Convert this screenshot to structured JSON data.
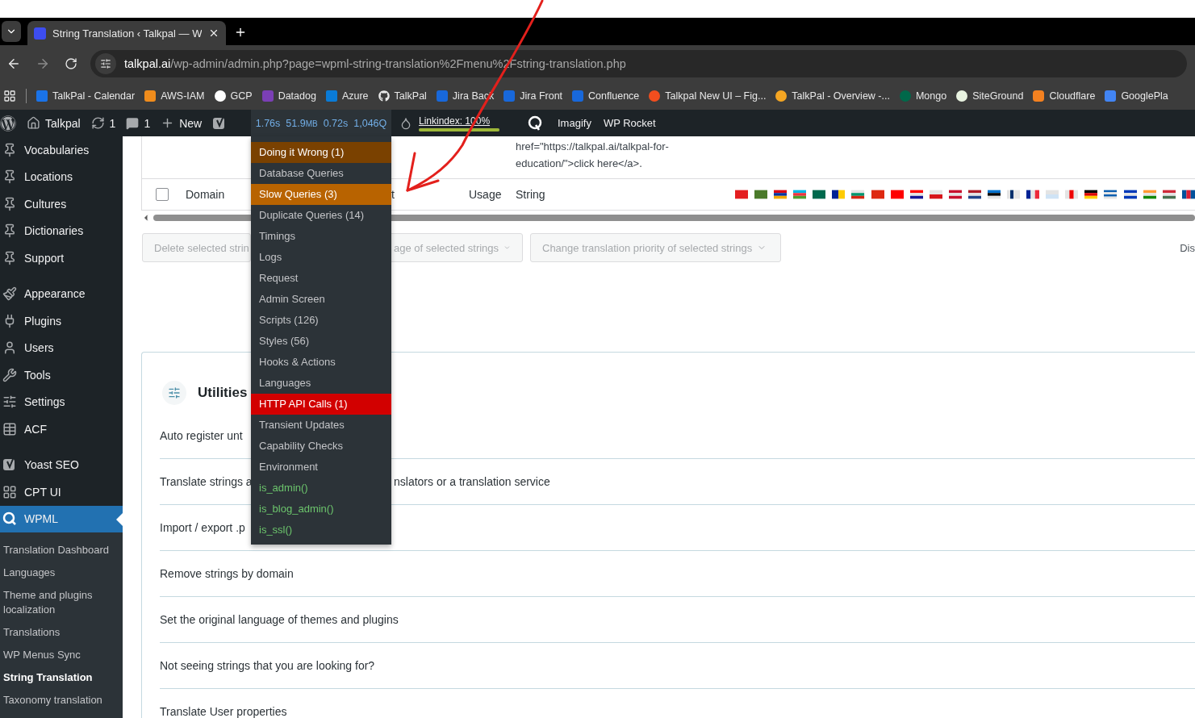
{
  "browser": {
    "tab": {
      "title": "String Translation ‹ Talkpal — W",
      "selected": true
    },
    "url": {
      "host": "talkpal.ai",
      "path": "/wp-admin/admin.php?page=wpml-string-translation%2Fmenu%2Fstring-translation.php"
    },
    "bookmarks": [
      {
        "label": "TalkPal - Calendar"
      },
      {
        "label": "AWS-IAM"
      },
      {
        "label": "GCP"
      },
      {
        "label": "Datadog"
      },
      {
        "label": "Azure"
      },
      {
        "label": "TalkPal"
      },
      {
        "label": "Jira Back"
      },
      {
        "label": "Jira Front"
      },
      {
        "label": "Confluence"
      },
      {
        "label": "Talkpal New UI – Fig..."
      },
      {
        "label": "TalkPal - Overview -..."
      },
      {
        "label": "Mongo"
      },
      {
        "label": "SiteGround"
      },
      {
        "label": "Cloudflare"
      },
      {
        "label": "GooglePla"
      }
    ]
  },
  "admin_bar": {
    "site": "Talkpal",
    "updates": "1",
    "comments": "1",
    "new": "New",
    "qm": {
      "time": "1.76s",
      "memory": "51.9",
      "memory_unit": "MB",
      "db_time": "0.72s",
      "queries": "1,046Q"
    },
    "linkindex": {
      "label": "Linkindex: 100%",
      "level": 1
    },
    "imagify": "Imagify",
    "wp_rocket": "WP Rocket"
  },
  "qm_menu": [
    {
      "label": "Doing it Wrong (1)",
      "kind": "warning"
    },
    {
      "label": "Database Queries",
      "kind": "normal"
    },
    {
      "label": "Slow Queries (3)",
      "kind": "slow"
    },
    {
      "label": "Duplicate Queries (14)",
      "kind": "normal"
    },
    {
      "label": "Timings",
      "kind": "normal"
    },
    {
      "label": "Logs",
      "kind": "normal"
    },
    {
      "label": "Request",
      "kind": "normal"
    },
    {
      "label": "Admin Screen",
      "kind": "normal"
    },
    {
      "label": "Scripts (126)",
      "kind": "normal"
    },
    {
      "label": "Styles (56)",
      "kind": "normal"
    },
    {
      "label": "Hooks & Actions",
      "kind": "normal"
    },
    {
      "label": "Languages",
      "kind": "normal"
    },
    {
      "label": "HTTP API Calls (1)",
      "kind": "error"
    },
    {
      "label": "Transient Updates",
      "kind": "normal"
    },
    {
      "label": "Capability Checks",
      "kind": "normal"
    },
    {
      "label": "Environment",
      "kind": "normal"
    },
    {
      "label": "is_admin()",
      "kind": "check"
    },
    {
      "label": "is_blog_admin()",
      "kind": "check"
    },
    {
      "label": "is_ssl()",
      "kind": "check"
    }
  ],
  "sidebar": {
    "items": [
      {
        "label": "Vocabularies",
        "selected": false
      },
      {
        "label": "Locations",
        "selected": false
      },
      {
        "label": "Cultures",
        "selected": false
      },
      {
        "label": "Dictionaries",
        "selected": false
      },
      {
        "label": "Support",
        "selected": false
      },
      {
        "label": "Appearance",
        "selected": false
      },
      {
        "label": "Plugins",
        "selected": false
      },
      {
        "label": "Users",
        "selected": false
      },
      {
        "label": "Tools",
        "selected": false
      },
      {
        "label": "Settings",
        "selected": false
      },
      {
        "label": "ACF",
        "selected": false
      },
      {
        "label": "Yoast SEO",
        "selected": false
      },
      {
        "label": "CPT UI",
        "selected": false
      },
      {
        "label": "WPML",
        "selected": true
      }
    ],
    "submenu": [
      {
        "label": "Translation Dashboard",
        "selected": false
      },
      {
        "label": "Languages",
        "selected": false
      },
      {
        "label": "Theme and plugins localization",
        "selected": false
      },
      {
        "label": "Translations",
        "selected": false
      },
      {
        "label": "WP Menus Sync",
        "selected": false
      },
      {
        "label": "String Translation",
        "selected": true
      },
      {
        "label": "Taxonomy translation",
        "selected": false
      }
    ]
  },
  "table": {
    "snippet": "href=\"https://talkpal.ai/talkpal-for-education/\">click here</a>.",
    "select_all": {
      "checked": false
    },
    "columns": [
      "Domain",
      "t",
      "Usage",
      "String"
    ]
  },
  "bulk_actions": [
    {
      "label": "Delete selected strin"
    },
    {
      "label": "age of selected strings",
      "dropdown": true
    },
    {
      "label": "Change translation priority of selected strings",
      "dropdown": true
    }
  ],
  "right_cut": "Dis",
  "utilities": {
    "title": "Utilities",
    "rows": [
      {
        "parts": [
          "Auto register unt"
        ]
      },
      {
        "parts": [
          "Translate strings a",
          "nslators or a translation service"
        ]
      },
      {
        "parts": [
          "Import / export .p"
        ]
      },
      {
        "parts": [
          "Remove strings by domain"
        ]
      },
      {
        "parts": [
          "Set the original language of themes and plugins"
        ]
      },
      {
        "parts": [
          "Not seeing strings that you are looking for?"
        ]
      },
      {
        "parts": [
          "Translate User properties"
        ]
      }
    ]
  }
}
